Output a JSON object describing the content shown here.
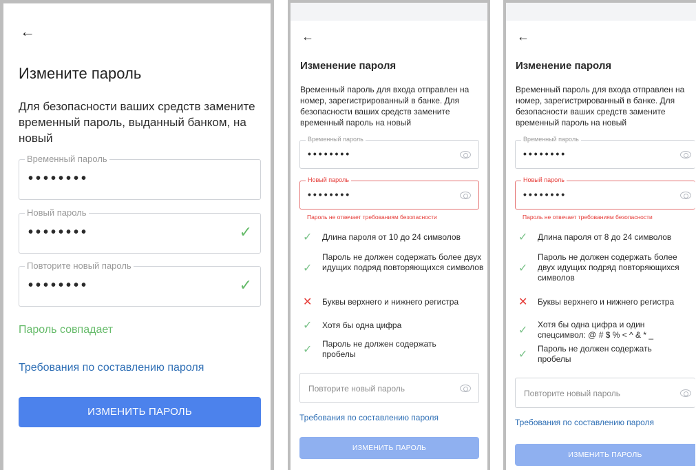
{
  "screen1": {
    "title": "Измените пароль",
    "description": "Для безопасности ваших средств замените временный пароль, выданный банком, на новый",
    "temp_label": "Временный пароль",
    "temp_value": "••••••••",
    "new_label": "Новый пароль",
    "new_value": "••••••••",
    "repeat_label": "Повторите новый пароль",
    "repeat_value": "••••••••",
    "match_text": "Пароль совпадает",
    "requirements_link": "Требования по составлению пароля",
    "submit": "ИЗМЕНИТЬ ПАРОЛЬ"
  },
  "screen2": {
    "title": "Изменение пароля",
    "description": "Временный пароль для входа отправлен на номер, зарегистрированный в банке. Для безопасности ваших средств замените временный пароль на новый",
    "temp_label": "Временный пароль",
    "temp_value": "••••••••",
    "new_label": "Новый пароль",
    "new_value": "••••••••",
    "error": "Пароль не отвечает требованиям безопасности",
    "requirements": [
      {
        "text": "Длина пароля от 10 до 24 символов",
        "status": "ok"
      },
      {
        "text": "Пароль не должен содержать более двух идущих подряд повторяющихся символов",
        "status": "ok"
      },
      {
        "text": "Буквы верхнего и нижнего регистра",
        "status": "bad"
      },
      {
        "text": "Хотя бы одна цифра",
        "status": "ok"
      },
      {
        "text": "Пароль не должен содержать пробелы",
        "status": "ok"
      }
    ],
    "repeat_placeholder": "Повторите новый пароль",
    "requirements_link": "Требования по составлению пароля",
    "submit": "ИЗМЕНИТЬ ПАРОЛЬ"
  },
  "screen3": {
    "title": "Изменение пароля",
    "description": "Временный пароль для входа отправлен на номер, зарегистрированный в банке. Для безопасности ваших средств замените временный пароль на новый",
    "temp_label": "Временный пароль",
    "temp_value": "••••••••",
    "new_label": "Новый пароль",
    "new_value": "••••••••",
    "error": "Пароль не отвечает требованиям безопасности",
    "requirements": [
      {
        "text": "Длина пароля от 8 до 24 символов",
        "status": "ok"
      },
      {
        "text": "Пароль не должен содержать более двух идущих подряд повторяющихся символов",
        "status": "ok"
      },
      {
        "text": "Буквы верхнего и нижнего регистра",
        "status": "bad"
      },
      {
        "text": "Хотя бы одна цифра и один спецсимвол: @ # $ % < ^ & * _",
        "status": "ok"
      },
      {
        "text": "Пароль не должен содержать пробелы",
        "status": "ok"
      }
    ],
    "repeat_placeholder": "Повторите новый пароль",
    "requirements_link": "Требования по составлению пароля",
    "submit": "ИЗМЕНИТЬ ПАРОЛЬ"
  },
  "icons": {
    "back": "←",
    "check": "✓",
    "cross": "✕"
  },
  "colors": {
    "primary_button": "#4c82ec",
    "disabled_button": "#8fb0f0",
    "link": "#2f6fb5",
    "success": "#66bb6a",
    "error": "#e53935"
  }
}
